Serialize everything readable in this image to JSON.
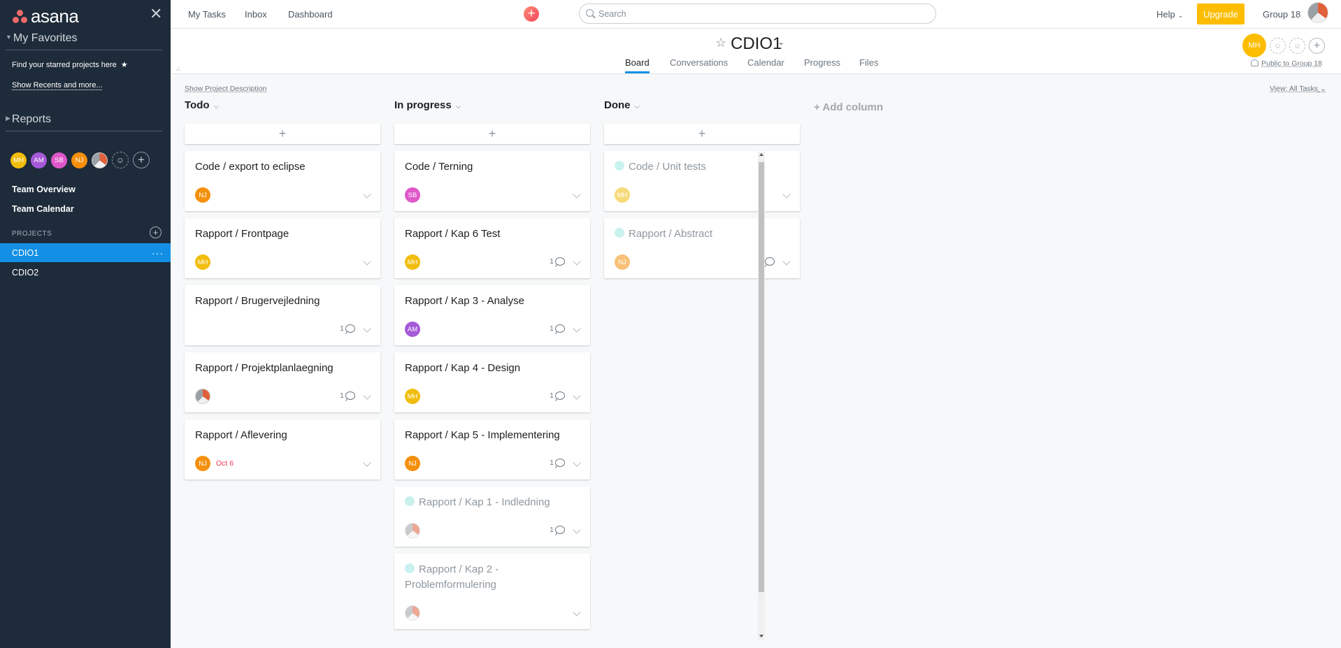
{
  "sidebar": {
    "logo_text": "asana",
    "close_glyph": "✕",
    "favorites_header": "My Favorites",
    "favorites_hint": "Find your starred projects here",
    "show_recents": "Show Recents and more...",
    "reports_header": "Reports",
    "team_members": [
      {
        "initials": "MH",
        "color": "#f1bd0c"
      },
      {
        "initials": "AM",
        "color": "#a55ad9"
      },
      {
        "initials": "SB",
        "color": "#df58ca"
      },
      {
        "initials": "NJ",
        "color": "#f5900d"
      }
    ],
    "team_overview": "Team Overview",
    "team_calendar": "Team Calendar",
    "projects_header": "PROJECTS",
    "projects": [
      {
        "label": "CDIO1",
        "active": true
      },
      {
        "label": "CDIO2",
        "active": false
      }
    ],
    "more_glyph": "···"
  },
  "topbar": {
    "nav": [
      "My Tasks",
      "Inbox",
      "Dashboard"
    ],
    "search_placeholder": "Search",
    "help": "Help",
    "upgrade": "Upgrade",
    "group": "Group 18",
    "accent": "#fcbd01"
  },
  "header": {
    "project_title": "CDIO1",
    "tabs": [
      "Board",
      "Conversations",
      "Calendar",
      "Progress",
      "Files"
    ],
    "active_tab": "Board",
    "member_initials": "MH",
    "public_label": "Public to Group 18"
  },
  "board": {
    "show_description": "Show Project Description",
    "view_all": "View: All Tasks",
    "add_column": "+ Add column",
    "add_task_glyph": "+",
    "columns": [
      {
        "title": "Todo",
        "cards": [
          {
            "name": "Code / export to eclipse",
            "assignee": "NJ",
            "comments": "",
            "date": "",
            "done": false
          },
          {
            "name": "Rapport / Frontpage",
            "assignee": "MH",
            "comments": "",
            "date": "",
            "done": false
          },
          {
            "name": "Rapport / Brugervejledning",
            "assignee": "",
            "comments": "1",
            "date": "",
            "done": false
          },
          {
            "name": "Rapport / Projektplanlaegning",
            "assignee": "photo",
            "comments": "1",
            "date": "",
            "done": false
          },
          {
            "name": "Rapport / Aflevering",
            "assignee": "NJ",
            "comments": "",
            "date": "Oct 6",
            "done": false
          }
        ]
      },
      {
        "title": "In progress",
        "cards": [
          {
            "name": "Code / Terning",
            "assignee": "SB",
            "comments": "",
            "date": "",
            "done": false
          },
          {
            "name": "Rapport / Kap 6 Test",
            "assignee": "MH",
            "comments": "1",
            "date": "",
            "done": false
          },
          {
            "name": "Rapport / Kap 3 - Analyse",
            "assignee": "AM",
            "comments": "1",
            "date": "",
            "done": false
          },
          {
            "name": "Rapport / Kap 4 - Design",
            "assignee": "MH",
            "comments": "1",
            "date": "",
            "done": false
          },
          {
            "name": "Rapport / Kap 5 - Implementering",
            "assignee": "NJ",
            "comments": "1",
            "date": "",
            "done": false
          },
          {
            "name": "Rapport / Kap 1 - Indledning",
            "assignee": "photo",
            "comments": "1",
            "date": "",
            "done": true
          },
          {
            "name": "Rapport / Kap 2 - Problemformulering",
            "assignee": "photo",
            "comments": "",
            "date": "",
            "done": true
          }
        ]
      },
      {
        "title": "Done",
        "cards": [
          {
            "name": "Code / Unit tests",
            "assignee": "MH",
            "comments": "",
            "date": "",
            "done": true
          },
          {
            "name": "Rapport / Abstract",
            "assignee": "NJ",
            "comments": "1",
            "date": "",
            "done": true
          }
        ]
      }
    ]
  }
}
